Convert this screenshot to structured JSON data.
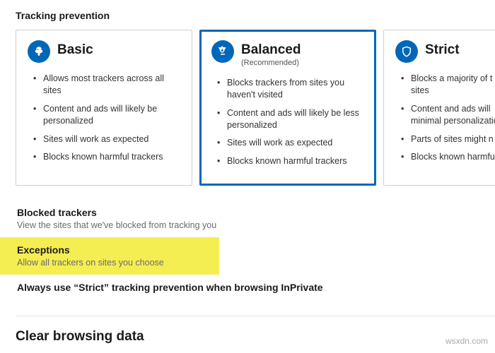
{
  "header": "Tracking prevention",
  "cards": {
    "basic": {
      "title": "Basic",
      "bullets": [
        "Allows most trackers across all sites",
        "Content and ads will likely be personalized",
        "Sites will work as expected",
        "Blocks known harmful trackers"
      ]
    },
    "balanced": {
      "title": "Balanced",
      "subtitle": "(Recommended)",
      "bullets": [
        "Blocks trackers from sites you haven't visited",
        "Content and ads will likely be less personalized",
        "Sites will work as expected",
        "Blocks known harmful trackers"
      ]
    },
    "strict": {
      "title": "Strict",
      "bullets": [
        "Blocks a majority of t",
        "Content and ads will",
        "Parts of sites might n",
        "Blocks known harmfu"
      ],
      "bullet1_line2": "sites",
      "bullet2_line2": "minimal personalizatio"
    }
  },
  "links": {
    "blocked": {
      "title": "Blocked trackers",
      "desc": "View the sites that we've blocked from tracking you"
    },
    "exceptions": {
      "title": "Exceptions",
      "desc": "Allow all trackers on sites you choose"
    },
    "inprivate": {
      "title": "Always use “Strict” tracking prevention when browsing InPrivate"
    }
  },
  "clear_section": "Clear browsing data",
  "watermark": "wsxdn.com"
}
